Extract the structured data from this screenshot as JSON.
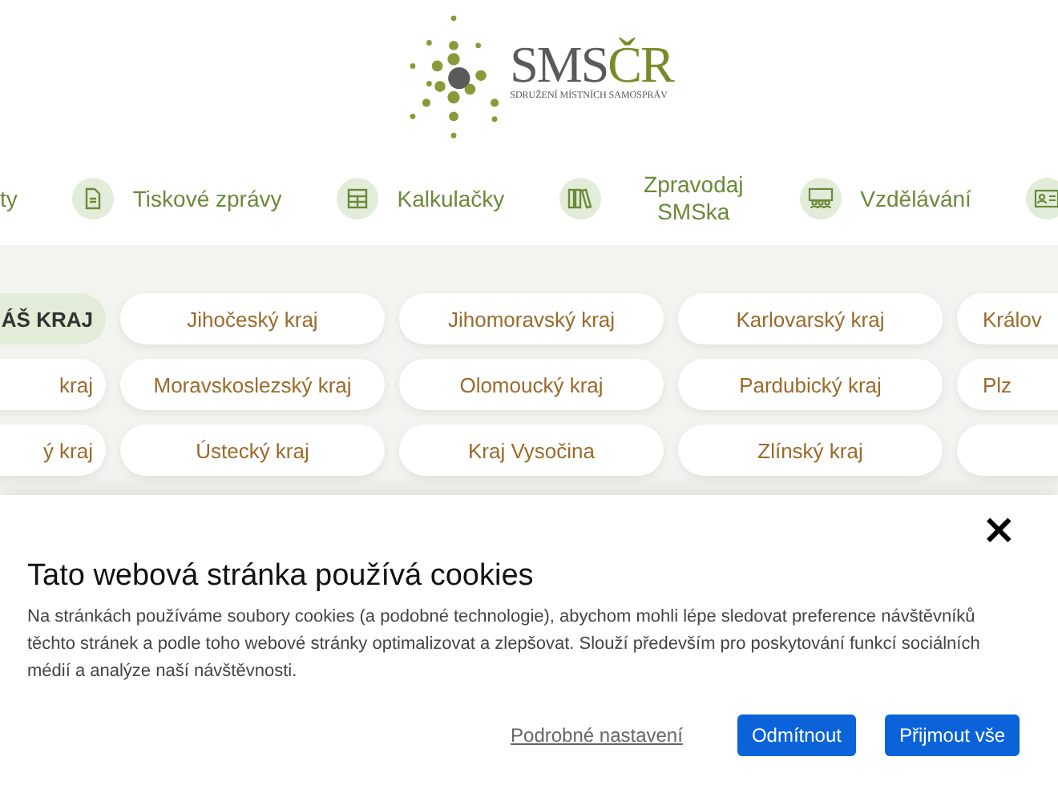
{
  "logo": {
    "text_main": "SMS",
    "text_accent": "ČR",
    "subtitle": "SDRUŽENÍ MÍSTNÍCH SAMOSPRÁV"
  },
  "nav": [
    {
      "label": "ty",
      "kind": "text"
    },
    {
      "label": "Tiskové zprávy",
      "kind": "document"
    },
    {
      "label": "Kalkulačky",
      "kind": "calculator"
    },
    {
      "label": "Zpravodaj SMSka",
      "kind": "books"
    },
    {
      "label": "Vzdělávání",
      "kind": "classroom"
    },
    {
      "kind": "idcard"
    }
  ],
  "regions": [
    {
      "label": "ÁŠ KRAJ",
      "selected": true
    },
    {
      "label": "Jihočeský kraj",
      "selected": false
    },
    {
      "label": "Jihomoravský kraj",
      "selected": false
    },
    {
      "label": "Karlovarský kraj",
      "selected": false
    },
    {
      "label": "Králov",
      "selected": false
    },
    {
      "label": "kraj",
      "selected": false
    },
    {
      "label": "Moravskoslezský kraj",
      "selected": false
    },
    {
      "label": "Olomoucký kraj",
      "selected": false
    },
    {
      "label": "Pardubický kraj",
      "selected": false
    },
    {
      "label": "Plz",
      "selected": false
    },
    {
      "label": "ý kraj",
      "selected": false
    },
    {
      "label": "Ústecký kraj",
      "selected": false
    },
    {
      "label": "Kraj Vysočina",
      "selected": false
    },
    {
      "label": "Zlínský kraj",
      "selected": false
    },
    {
      "selected": false
    }
  ],
  "cookie": {
    "close": "×",
    "title": "Tato webová stránka používá cookies",
    "text": "Na stránkách používáme soubory cookies (a podobné technologie), abychom mohli lépe sledovat preference návštěvníků těchto stránek a podle toho webové stránky optimalizovat a zlepšovat. Slouží především pro poskytování funkcí sociálních médií a analýze naší návštěvnosti.",
    "settings_link": "Podrobné nastavení",
    "buttons": [
      "Odmítnout",
      "Přijmout vše"
    ]
  }
}
